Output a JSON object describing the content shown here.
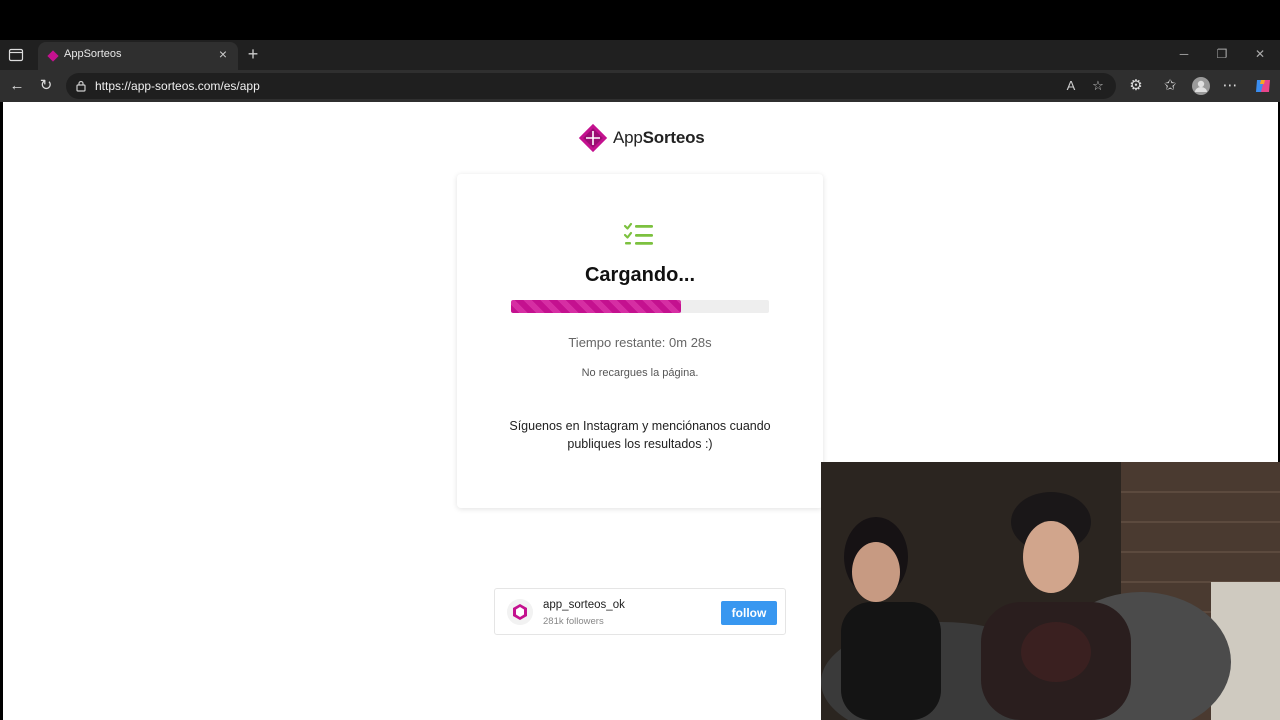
{
  "browser": {
    "tab_title": "AppSorteos",
    "new_tab_symbol": "+",
    "url": "https://app-sorteos.com/es/app"
  },
  "logo": {
    "text_light": "App",
    "text_bold": "Sorteos"
  },
  "loader": {
    "title": "Cargando...",
    "progress_fraction": 0.66,
    "time_remaining": "Tiempo restante: 0m 28s",
    "no_reload": "No recargues la página.",
    "instagram_message": "Síguenos en Instagram y menciónanos cuando publiques los resultados :)"
  },
  "instagram_widget": {
    "username": "app_sorteos_ok",
    "followers": "281k followers",
    "follow_label": "follow"
  },
  "colors": {
    "brand": "#c4118f",
    "check_green": "#7cc13f",
    "follow_blue": "#3897f0"
  }
}
